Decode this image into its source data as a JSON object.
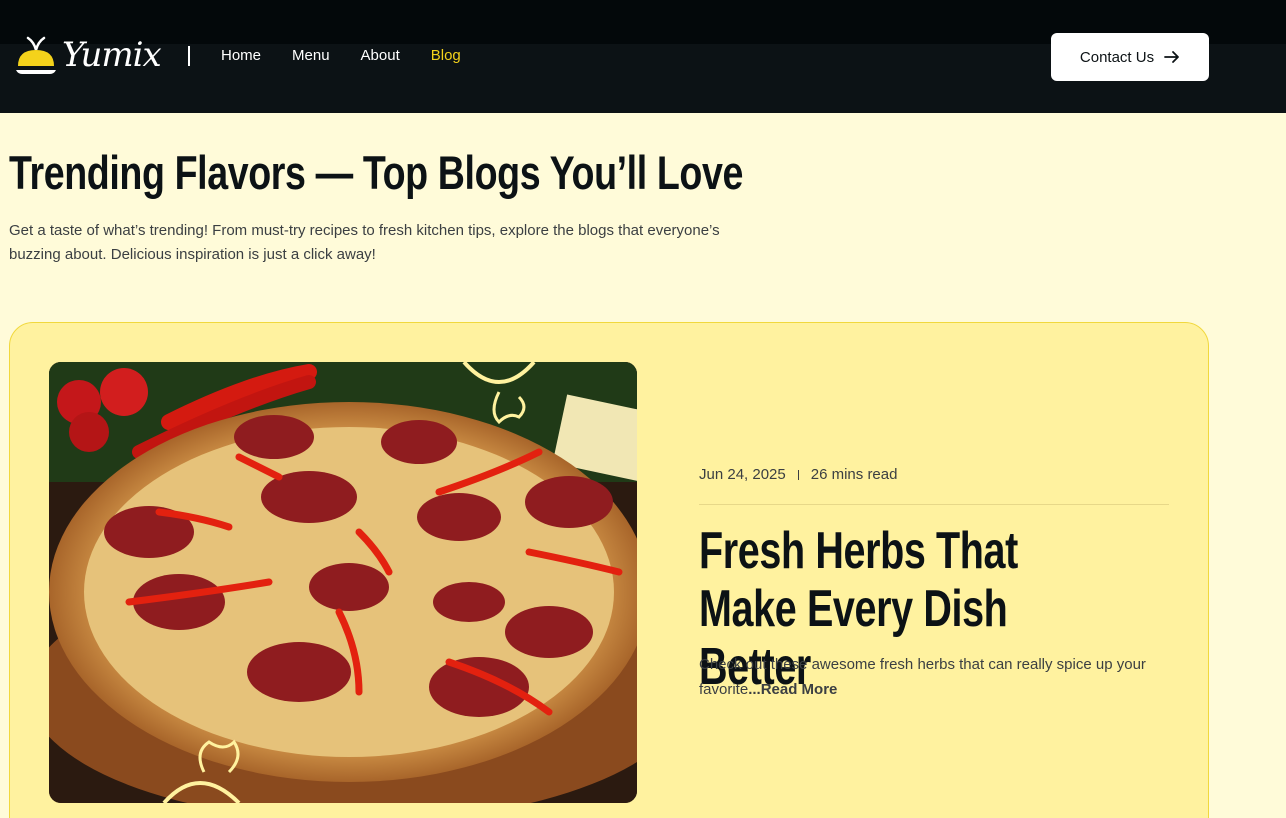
{
  "header": {
    "logo_text": "Yumix",
    "nav": [
      {
        "label": "Home",
        "active": false
      },
      {
        "label": "Menu",
        "active": false
      },
      {
        "label": "About",
        "active": false
      },
      {
        "label": "Blog",
        "active": true
      }
    ],
    "contact_label": "Contact Us"
  },
  "hero": {
    "title": "Trending Flavors — Top Blogs You’ll Love",
    "subtitle": "Get a taste of what’s trending! From must-try recipes to fresh kitchen tips, explore the blogs that everyone’s buzzing about. Delicious inspiration is just a click away!"
  },
  "post": {
    "date": "Jun 24, 2025",
    "read_time": "26 mins read",
    "title": "Fresh Herbs That Make Every Dish Better",
    "excerpt": "Check out these awesome fresh herbs that can really spice up your favorite",
    "read_more": "...Read More",
    "image_icon": "pepperoni-pizza-photo"
  },
  "colors": {
    "header_bg": "#0c1215",
    "page_bg": "#fffbd9",
    "card_bg": "#fff29f",
    "accent": "#f4d21b"
  }
}
